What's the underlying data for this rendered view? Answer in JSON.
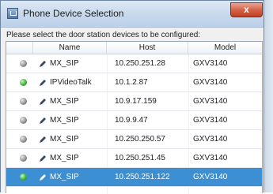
{
  "window": {
    "title": "Phone Device Selection",
    "close_glyph": "x"
  },
  "instruction": "Please select the door station devices to be configured:",
  "table": {
    "columns": [
      "",
      "Name",
      "Host",
      "Model"
    ],
    "rows": [
      {
        "status": "grey",
        "name": "MX_SIP",
        "host": "10.250.251.28",
        "model": "GXV3140",
        "selected": false
      },
      {
        "status": "green",
        "name": "IPVideoTalk",
        "host": "10.1.2.87",
        "model": "GXV3140",
        "selected": false
      },
      {
        "status": "grey",
        "name": "MX_SIP",
        "host": "10.9.17.159",
        "model": "GXV3140",
        "selected": false
      },
      {
        "status": "grey",
        "name": "MX_SIP",
        "host": "10.9.9.47",
        "model": "GXV3140",
        "selected": false
      },
      {
        "status": "grey",
        "name": "MX_SIP",
        "host": "10.250.250.57",
        "model": "GXV3140",
        "selected": false
      },
      {
        "status": "grey",
        "name": "MX_SIP",
        "host": "10.250.251.45",
        "model": "GXV3140",
        "selected": false
      },
      {
        "status": "green",
        "name": "MX_SIP",
        "host": "10.250.251.122",
        "model": "GXV3140",
        "selected": true
      }
    ]
  },
  "colors": {
    "selected_row": "#3b8fd2",
    "online": "#3fb33a",
    "offline": "#8c8c8c",
    "close": "#c2401f"
  },
  "icons": {
    "status": "status-dot-icon",
    "edit": "edit-pencil-icon",
    "app": "app-window-icon"
  }
}
